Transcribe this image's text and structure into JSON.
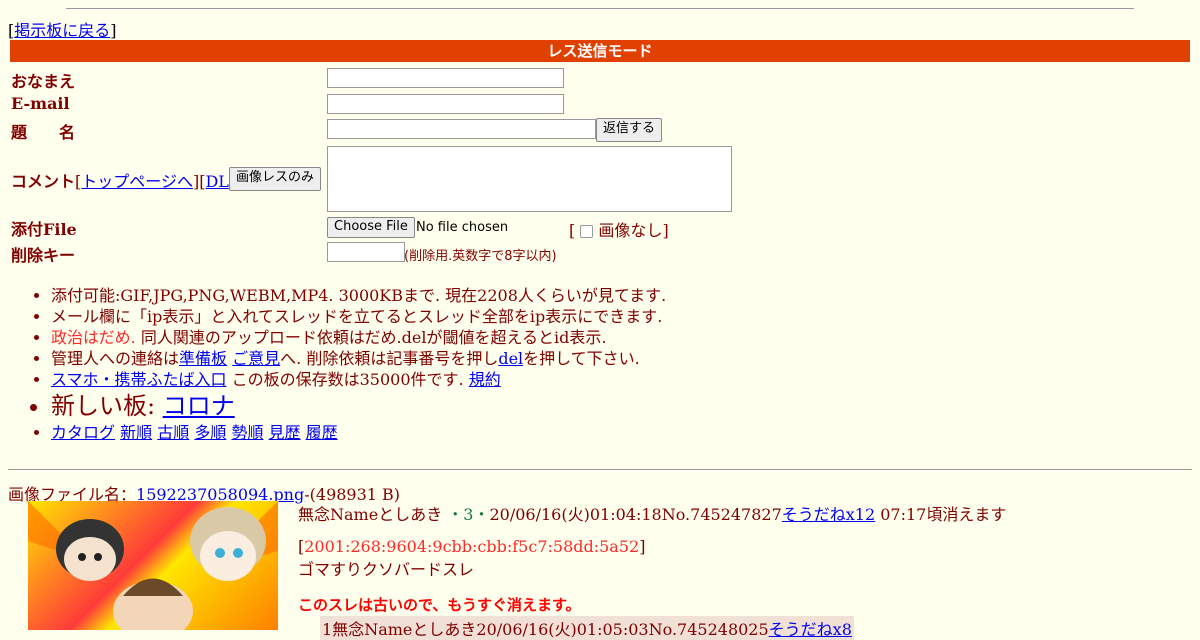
{
  "nav": {
    "back_open": "[",
    "back_label": "掲示板に戻る",
    "back_close": "]"
  },
  "mode_bar": "レス送信モード",
  "form": {
    "name_label": "おなまえ",
    "email_label": "E-mail",
    "subject_label": "題　　名",
    "submit_label": "返信する",
    "comment_label": "コメント",
    "toppage_label": "トップページへ",
    "dl_label": "DL",
    "image_only_label": "画像レスのみ",
    "file_label": "添付File",
    "choose_file_label": "Choose File",
    "no_file_text": "No file chosen",
    "no_image_label": "画像なし",
    "delkey_label": "削除キー",
    "delkey_hint": "(削除用.英数字で8字以内)"
  },
  "rules": {
    "line1": "添付可能:GIF,JPG,PNG,WEBM,MP4. 3000KBまで. 現在2208人くらいが見てます.",
    "line2": "メール欄に「ip表示」と入れてスレッドを立てるとスレッド全部をip表示にできます.",
    "line3_red": "政治はだめ.",
    "line3_rest": " 同人関連のアップロード依頼はだめ.delが閾値を超えるとid表示.",
    "line4_a": "管理人への連絡は",
    "line4_link1": "準備板",
    "line4_link2": "ご意見",
    "line4_b": "へ. 削除依頼は記事番号を押し",
    "line4_link3": "del",
    "line4_c": "を押して下さい.",
    "line5_link": "スマホ・携帯ふたば入口",
    "line5_text": " この板の保存数は35000件です. ",
    "line5_link2": "規約",
    "line6_text": "新しい板: ",
    "line6_link": "コロナ",
    "line7_links": [
      "カタログ",
      "新順",
      "古順",
      "多順",
      "勢順",
      "見歴",
      "履歴"
    ]
  },
  "thread": {
    "file_prefix": "画像ファイル名：",
    "file_name": "1592237058094.png",
    "file_size": "-(498931 B)",
    "subject": "無念",
    "name": "Nameとしあき",
    "id_dot": "・3・",
    "date": "20/06/16(火)01:04:18",
    "no": "No.745247827",
    "soudane": "そうだねx12",
    "expire": " 07:17頃消えます",
    "ip": "2001:268:9604:9cbb:cbb:f5c7:58dd:5a52",
    "comment": "ゴマすりクソバードスレ",
    "warning": "このスレは古いので、もうすぐ消えます。"
  },
  "reply": {
    "num": "1",
    "subject": "無念",
    "name": "Nameとしあき",
    "date": "20/06/16(火)01:05:03",
    "no": "No.745248025",
    "soudane": "そうだねx8"
  },
  "colors": {
    "accent": "#e04000",
    "background": "#ffffee",
    "text": "#800000",
    "link": "#0000ee",
    "reply_bg": "#f0e0d6"
  }
}
